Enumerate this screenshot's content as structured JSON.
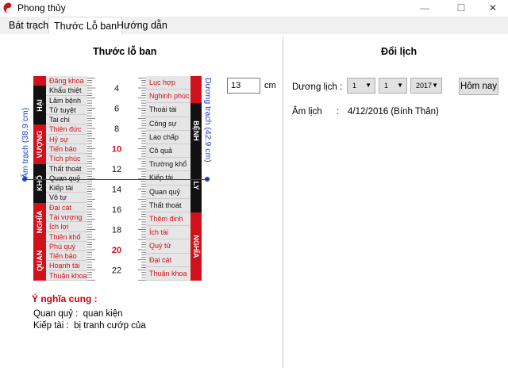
{
  "window": {
    "title": "Phong thủy",
    "minimize": "—",
    "maximize": "☐",
    "close": "✕"
  },
  "tabs": [
    "Bát trạch",
    "Thước Lỗ ban",
    "Hướng dẫn"
  ],
  "left": {
    "title": "Thước lỗ ban",
    "am_trach_label": "Âm trạch (38.9 cm)",
    "duong_trach_label": "Dương trạch (42.9 cm)",
    "input_value": "13",
    "unit": "cm",
    "left_column": [
      "Đăng khoa",
      "Khẩu thiệt",
      "Lâm bệnh",
      "Tử tuyệt",
      "Tai chí",
      "Thiên đức",
      "Hỷ sự",
      "Tiến bảo",
      "Tích phúc",
      "Thất thoát",
      "Quan quỷ",
      "Kiếp tài",
      "Vô tự",
      "Đại cát",
      "Tài vượng",
      "Ích lợi",
      "Thiên khố",
      "Phú quý",
      "Tiến bảo",
      "Hoạnh tài",
      "Thuận khoa"
    ],
    "left_red": [
      true,
      false,
      false,
      false,
      false,
      true,
      true,
      true,
      true,
      false,
      false,
      false,
      false,
      true,
      true,
      true,
      true,
      true,
      true,
      true,
      true
    ],
    "left_groups": [
      {
        "label": "",
        "rows": 1,
        "color": "#d0101a"
      },
      {
        "label": "HẠI",
        "rows": 4,
        "color": "#111111"
      },
      {
        "label": "VƯỢNG",
        "rows": 4,
        "color": "#d0101a"
      },
      {
        "label": "KHỔ",
        "rows": 4,
        "color": "#111111"
      },
      {
        "label": "NGHĨA",
        "rows": 4,
        "color": "#d0101a"
      },
      {
        "label": "QUAN",
        "rows": 4,
        "color": "#d0101a"
      }
    ],
    "right_column": [
      "Lục hợp",
      "Nghinh phúc",
      "Thoái tài",
      "Công sự",
      "Lao chấp",
      "Cô quả",
      "Trường khổ",
      "Kiếp tài",
      "Quan quỷ",
      "Thất thoát",
      "Thêm đinh",
      "Ích tài",
      "Quý tử",
      "Đại cát",
      "Thuận khoa"
    ],
    "right_red": [
      true,
      true,
      false,
      false,
      false,
      false,
      false,
      false,
      false,
      false,
      true,
      true,
      true,
      true,
      true
    ],
    "right_groups": [
      {
        "label": "",
        "rows": 2,
        "color": "#d0101a"
      },
      {
        "label": "BỆNH",
        "rows": 4,
        "color": "#111111"
      },
      {
        "label": "LY",
        "rows": 4,
        "color": "#111111"
      },
      {
        "label": "NGHĨA",
        "rows": 5,
        "color": "#d0101a"
      }
    ],
    "scale_numbers": [
      {
        "v": "4",
        "red": false
      },
      {
        "v": "6",
        "red": false
      },
      {
        "v": "8",
        "red": false
      },
      {
        "v": "10",
        "red": true
      },
      {
        "v": "12",
        "red": false
      },
      {
        "v": "14",
        "red": false
      },
      {
        "v": "16",
        "red": false
      },
      {
        "v": "18",
        "red": false
      },
      {
        "v": "20",
        "red": true
      },
      {
        "v": "22",
        "red": false
      }
    ],
    "meaning_title": "Ý nghĩa cung :",
    "meaning_lines": [
      {
        "k": "Quan quỷ :",
        "v": "quan kiện"
      },
      {
        "k": "Kiếp tài :",
        "v": "bị tranh cướp của"
      }
    ]
  },
  "right": {
    "title": "Đổi lịch",
    "duong_lich_label": "Dương lịch :",
    "day": "1",
    "month": "1",
    "year": "2017",
    "today_button": "Hôm nay",
    "am_lich_label": "Âm lịch",
    "colon": ":",
    "am_lich_value": "4/12/2016 (Bính Thân)"
  },
  "colors": {
    "red": "#d0101a",
    "blue": "#1a3ec8",
    "black": "#111111"
  }
}
